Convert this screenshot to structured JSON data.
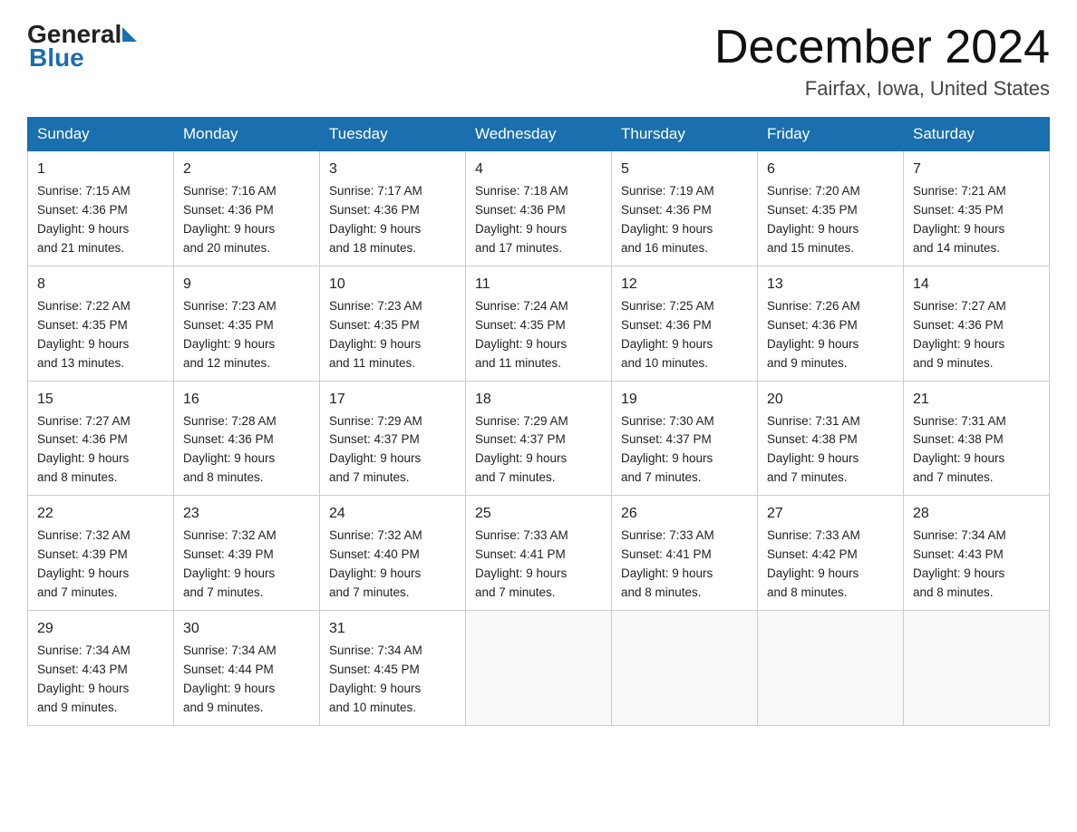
{
  "logo": {
    "line1": "General",
    "line2": "Blue"
  },
  "title": "December 2024",
  "subtitle": "Fairfax, Iowa, United States",
  "days_header": [
    "Sunday",
    "Monday",
    "Tuesday",
    "Wednesday",
    "Thursday",
    "Friday",
    "Saturday"
  ],
  "weeks": [
    [
      {
        "date": "1",
        "sunrise": "7:15 AM",
        "sunset": "4:36 PM",
        "daylight": "9 hours and 21 minutes."
      },
      {
        "date": "2",
        "sunrise": "7:16 AM",
        "sunset": "4:36 PM",
        "daylight": "9 hours and 20 minutes."
      },
      {
        "date": "3",
        "sunrise": "7:17 AM",
        "sunset": "4:36 PM",
        "daylight": "9 hours and 18 minutes."
      },
      {
        "date": "4",
        "sunrise": "7:18 AM",
        "sunset": "4:36 PM",
        "daylight": "9 hours and 17 minutes."
      },
      {
        "date": "5",
        "sunrise": "7:19 AM",
        "sunset": "4:36 PM",
        "daylight": "9 hours and 16 minutes."
      },
      {
        "date": "6",
        "sunrise": "7:20 AM",
        "sunset": "4:35 PM",
        "daylight": "9 hours and 15 minutes."
      },
      {
        "date": "7",
        "sunrise": "7:21 AM",
        "sunset": "4:35 PM",
        "daylight": "9 hours and 14 minutes."
      }
    ],
    [
      {
        "date": "8",
        "sunrise": "7:22 AM",
        "sunset": "4:35 PM",
        "daylight": "9 hours and 13 minutes."
      },
      {
        "date": "9",
        "sunrise": "7:23 AM",
        "sunset": "4:35 PM",
        "daylight": "9 hours and 12 minutes."
      },
      {
        "date": "10",
        "sunrise": "7:23 AM",
        "sunset": "4:35 PM",
        "daylight": "9 hours and 11 minutes."
      },
      {
        "date": "11",
        "sunrise": "7:24 AM",
        "sunset": "4:35 PM",
        "daylight": "9 hours and 11 minutes."
      },
      {
        "date": "12",
        "sunrise": "7:25 AM",
        "sunset": "4:36 PM",
        "daylight": "9 hours and 10 minutes."
      },
      {
        "date": "13",
        "sunrise": "7:26 AM",
        "sunset": "4:36 PM",
        "daylight": "9 hours and 9 minutes."
      },
      {
        "date": "14",
        "sunrise": "7:27 AM",
        "sunset": "4:36 PM",
        "daylight": "9 hours and 9 minutes."
      }
    ],
    [
      {
        "date": "15",
        "sunrise": "7:27 AM",
        "sunset": "4:36 PM",
        "daylight": "9 hours and 8 minutes."
      },
      {
        "date": "16",
        "sunrise": "7:28 AM",
        "sunset": "4:36 PM",
        "daylight": "9 hours and 8 minutes."
      },
      {
        "date": "17",
        "sunrise": "7:29 AM",
        "sunset": "4:37 PM",
        "daylight": "9 hours and 7 minutes."
      },
      {
        "date": "18",
        "sunrise": "7:29 AM",
        "sunset": "4:37 PM",
        "daylight": "9 hours and 7 minutes."
      },
      {
        "date": "19",
        "sunrise": "7:30 AM",
        "sunset": "4:37 PM",
        "daylight": "9 hours and 7 minutes."
      },
      {
        "date": "20",
        "sunrise": "7:31 AM",
        "sunset": "4:38 PM",
        "daylight": "9 hours and 7 minutes."
      },
      {
        "date": "21",
        "sunrise": "7:31 AM",
        "sunset": "4:38 PM",
        "daylight": "9 hours and 7 minutes."
      }
    ],
    [
      {
        "date": "22",
        "sunrise": "7:32 AM",
        "sunset": "4:39 PM",
        "daylight": "9 hours and 7 minutes."
      },
      {
        "date": "23",
        "sunrise": "7:32 AM",
        "sunset": "4:39 PM",
        "daylight": "9 hours and 7 minutes."
      },
      {
        "date": "24",
        "sunrise": "7:32 AM",
        "sunset": "4:40 PM",
        "daylight": "9 hours and 7 minutes."
      },
      {
        "date": "25",
        "sunrise": "7:33 AM",
        "sunset": "4:41 PM",
        "daylight": "9 hours and 7 minutes."
      },
      {
        "date": "26",
        "sunrise": "7:33 AM",
        "sunset": "4:41 PM",
        "daylight": "9 hours and 8 minutes."
      },
      {
        "date": "27",
        "sunrise": "7:33 AM",
        "sunset": "4:42 PM",
        "daylight": "9 hours and 8 minutes."
      },
      {
        "date": "28",
        "sunrise": "7:34 AM",
        "sunset": "4:43 PM",
        "daylight": "9 hours and 8 minutes."
      }
    ],
    [
      {
        "date": "29",
        "sunrise": "7:34 AM",
        "sunset": "4:43 PM",
        "daylight": "9 hours and 9 minutes."
      },
      {
        "date": "30",
        "sunrise": "7:34 AM",
        "sunset": "4:44 PM",
        "daylight": "9 hours and 9 minutes."
      },
      {
        "date": "31",
        "sunrise": "7:34 AM",
        "sunset": "4:45 PM",
        "daylight": "9 hours and 10 minutes."
      },
      null,
      null,
      null,
      null
    ]
  ],
  "labels": {
    "sunrise": "Sunrise:",
    "sunset": "Sunset:",
    "daylight": "Daylight:"
  }
}
